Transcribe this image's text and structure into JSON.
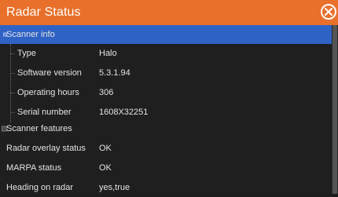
{
  "window": {
    "title": "Radar Status"
  },
  "tree": {
    "scanner_info": {
      "label": "Scanner info",
      "items": [
        {
          "label": "Type",
          "value": "Halo"
        },
        {
          "label": "Software version",
          "value": "5.3.1.94"
        },
        {
          "label": "Operating hours",
          "value": "306"
        },
        {
          "label": "Serial number",
          "value": "1608X32251"
        }
      ]
    },
    "scanner_features": {
      "label": "Scanner features"
    },
    "status_rows": [
      {
        "label": "Radar overlay status",
        "value": "OK"
      },
      {
        "label": "MARPA status",
        "value": "OK"
      },
      {
        "label": "Heading on radar",
        "value": "yes,true"
      }
    ]
  },
  "colors": {
    "titlebar": "#e8702a",
    "selected": "#2f62c5",
    "background": "#1f1f1f"
  },
  "icons": {
    "close": "close-icon",
    "expand": "expand-icon"
  }
}
